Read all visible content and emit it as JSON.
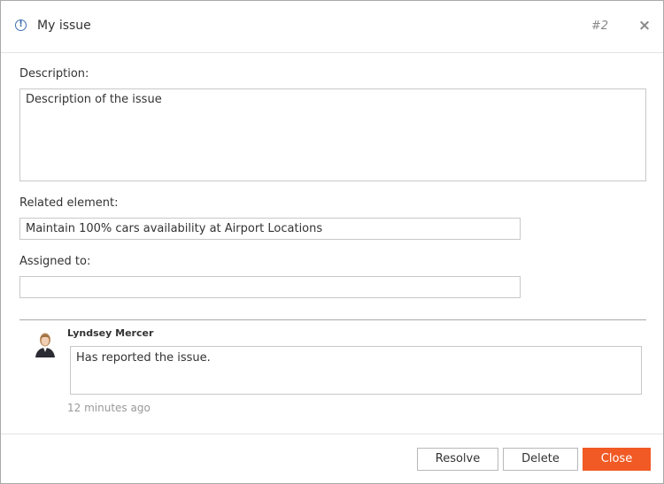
{
  "header": {
    "title": "My issue",
    "issue_number": "#2",
    "close_glyph": "×",
    "icon_glyph": "!"
  },
  "form": {
    "description_label": "Description:",
    "description_value": "Description of the issue",
    "related_label": "Related element:",
    "related_value": "Maintain 100% cars availability at Airport Locations",
    "assigned_label": "Assigned to:",
    "assigned_value": ""
  },
  "comment": {
    "author": "Lyndsey Mercer",
    "text": "Has reported the issue.",
    "time": "12 minutes ago"
  },
  "footer": {
    "resolve_label": "Resolve",
    "delete_label": "Delete",
    "close_label": "Close"
  },
  "colors": {
    "accent": "#f15a24",
    "info_icon": "#3f6fb5"
  }
}
